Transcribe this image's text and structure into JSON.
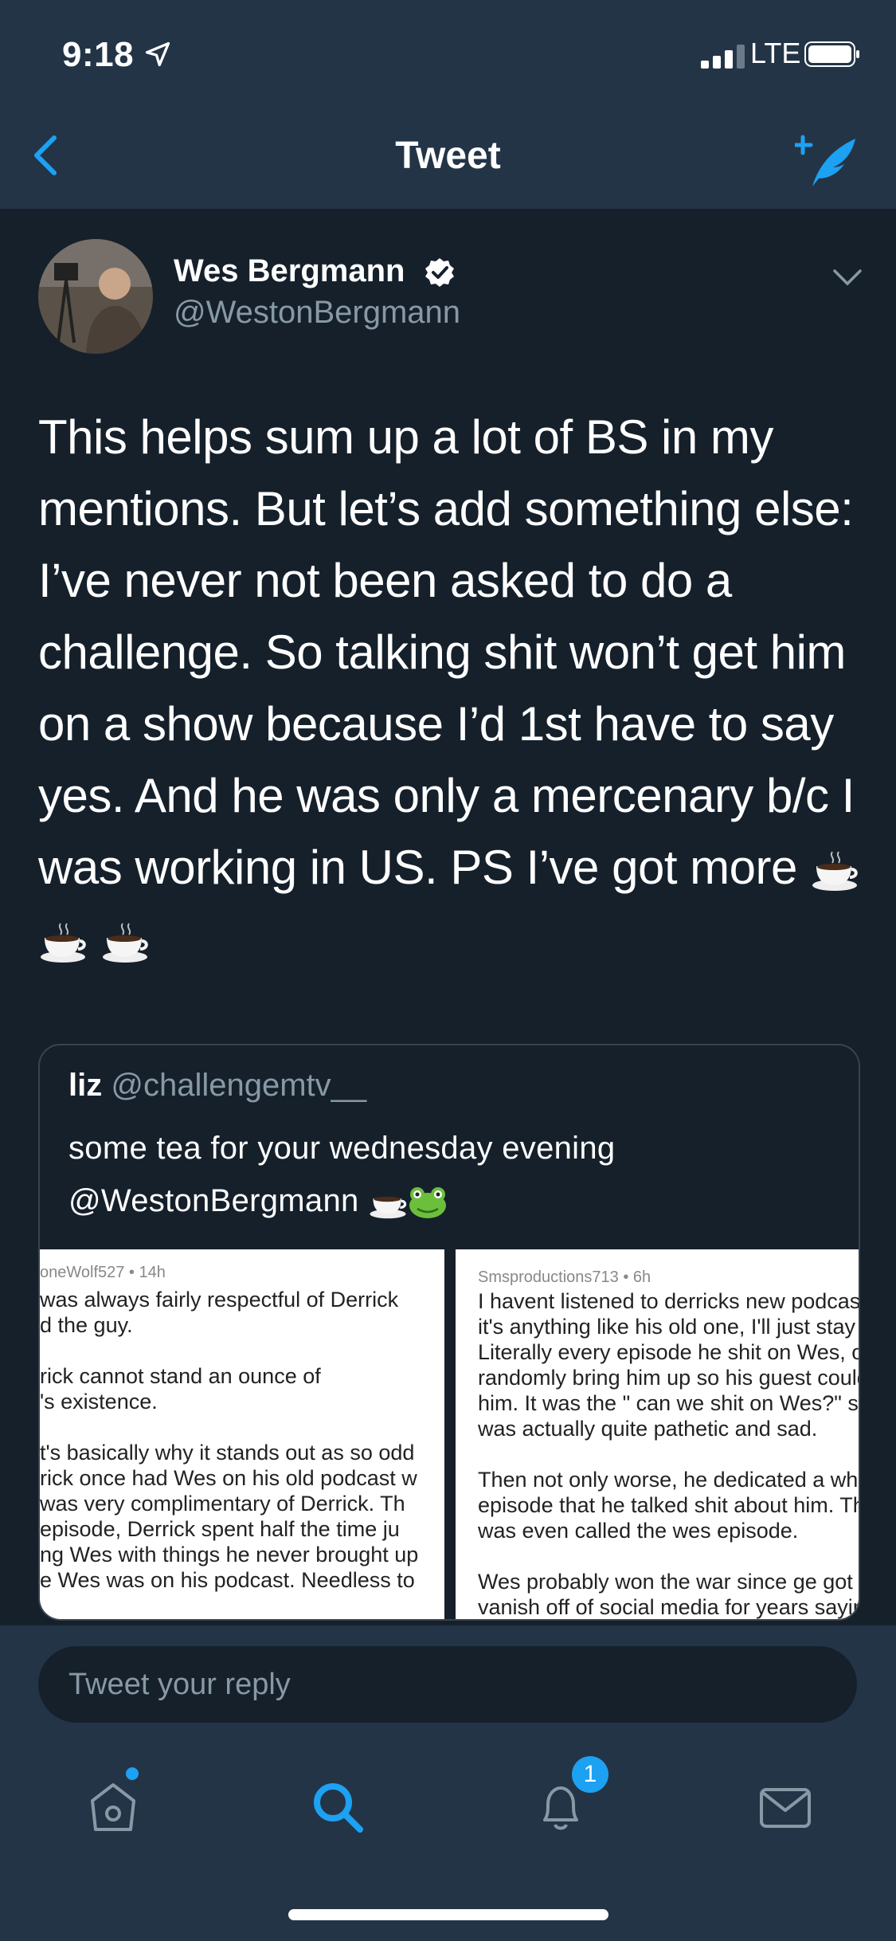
{
  "status_bar": {
    "time": "9:18",
    "network": "LTE"
  },
  "nav": {
    "title": "Tweet"
  },
  "tweet": {
    "author_name": "Wes Bergmann",
    "author_handle": "@WestonBergmann",
    "text_lines": [
      "This helps sum up a lot of BS in my",
      "mentions. But let’s add something else:",
      "I’ve never not been asked to do a",
      "challenge. So talking shit won’t get him",
      "on a show because I’d 1st have to say",
      "yes. And he was only a mercenary b/c I",
      "was working in US. PS I’ve got more"
    ]
  },
  "quote": {
    "author_name": "liz",
    "author_handle": "@challengemtv__",
    "text_line1": "some tea for your wednesday evening",
    "text_line2": "@WestonBergmann",
    "image1": {
      "meta": "oneWolf527 • 14h",
      "lines": [
        " was always fairly respectful of Derrick",
        "d the guy.",
        "",
        "rick cannot stand an ounce of",
        "'s existence.",
        "",
        "t's basically why it stands out as so odd",
        "rick once had Wes on his old podcast w",
        " was very complimentary of Derrick.  Th",
        " episode, Derrick spent half the time ju",
        "ng Wes with things he never brought up",
        "e Wes was on his podcast.  Needless to"
      ]
    },
    "image2": {
      "meta": "Smsproductions713 • 6h",
      "lines": [
        "I havent listened to derricks new podcast",
        "it's anything like his old one, I'll just stay",
        "Literally every episode he shit on Wes, or",
        "randomly bring him up so his guest could",
        "him. It was the \" can we shit on Wes?\" sh",
        "was actually quite pathetic and sad.",
        "",
        "Then not only worse, he dedicated a whol",
        "episode that he talked shit about him. Th",
        "was even called the wes episode.",
        "",
        "Wes probably won the war since ge got d",
        "vanish off of social media for years sayin"
      ]
    }
  },
  "reply": {
    "placeholder": "Tweet your reply"
  },
  "tabbar": {
    "notifications_badge": "1"
  },
  "colors": {
    "accent": "#1da1f2",
    "background": "#15202b",
    "header": "#243447",
    "muted": "#8899a6"
  },
  "icons": [
    "back-icon",
    "compose-icon",
    "verified-icon",
    "chevron-down-icon",
    "coffee-icon",
    "frog-icon",
    "home-icon",
    "search-icon",
    "bell-icon",
    "mail-icon"
  ]
}
